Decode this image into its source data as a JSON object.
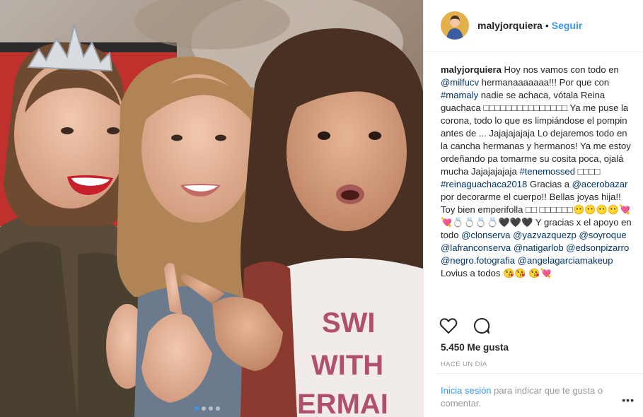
{
  "post": {
    "username": "malyjorquiera",
    "separator": "•",
    "follow_label": "Seguir",
    "caption_parts": [
      "Hoy nos vamos con todo en ",
      "@milfucv",
      " hermanaaaaaaa!!! Por que con ",
      "#mamaly",
      " nadie se achaca, vótala Reina guachaca □□□□□□□□□□□□□□□ Ya me puse la corona, todo lo que es limpiándose el pompin antes de ... Jajajajajaja Lo dejaremos todo en la cancha hermanas y hermanos! Ya me estoy ordeñando pa tomarme su cosita poca, ojalá mucha Jajajajajaja ",
      "#tenemossed",
      " □□□□ ",
      "#reinaguachaca2018",
      " Gracias a ",
      "@acerobazar",
      " por decorarme el cuerpo!! Bellas joyas hija!! Toy bien emperifolla □□ □□□□□□😶😶😶😶💘💘💍💍💍💍🖤🖤🖤 Y gracias x el apoyo en todo ",
      "@clonserva",
      " ",
      "@yazvazquezp",
      " ",
      "@soyroque",
      " ",
      "@lafranconserva",
      " ",
      "@natigarlob",
      " ",
      "@edsonpizarro",
      " ",
      "@negro.fotografia",
      " ",
      "@angelagarciamakeup",
      " Lovius a todos 😘😘 😘💘"
    ],
    "likes": "5.450 Me gusta",
    "timestamp": "Hace un día",
    "login_link": "Inicia sesión",
    "login_text": " para indicar que te gusta o comentar.",
    "more_label": "•••"
  },
  "icons": {
    "like": "heart-icon",
    "comment": "comment-icon"
  },
  "colors": {
    "accent": "#3897f0",
    "link": "#003569",
    "muted": "#999999"
  },
  "carousel": {
    "count": 4,
    "active": 1
  }
}
